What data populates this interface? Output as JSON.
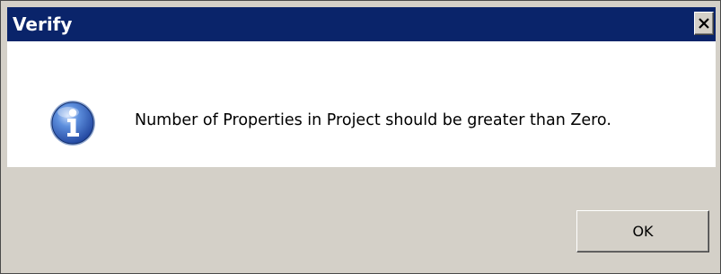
{
  "dialog": {
    "title": "Verify",
    "message": "Number of Properties in Project should be greater than Zero.",
    "icon": "info-icon",
    "close_icon": "close-icon",
    "ok_label": "OK"
  },
  "colors": {
    "titlebar": "#0a246a",
    "face": "#d4d0c8",
    "content": "#ffffff"
  }
}
